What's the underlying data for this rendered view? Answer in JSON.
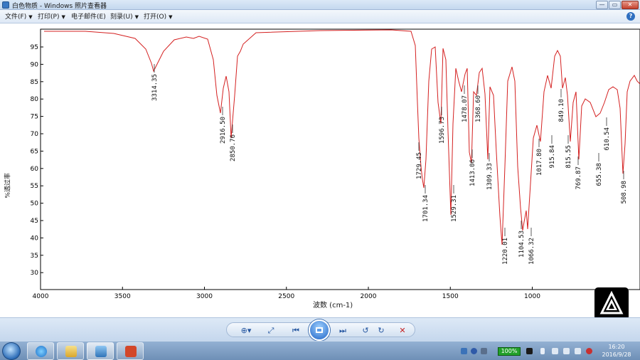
{
  "window": {
    "title": "白色物质 - Windows 照片查看器",
    "min_glyph": "—",
    "max_glyph": "▭",
    "close_glyph": "✕"
  },
  "menu": [
    {
      "label": "文件(F)",
      "caret": "▼"
    },
    {
      "label": "打印(P)",
      "caret": "▼"
    },
    {
      "label": "电子邮件(E)",
      "caret": ""
    },
    {
      "label": "刻录(U)",
      "caret": "▼"
    },
    {
      "label": "打开(O)",
      "caret": "▼"
    }
  ],
  "help_glyph": "?",
  "spectrum": {
    "y_axis_title": "%透过率",
    "x_axis_title": "波数 (cm-1)",
    "y_ticks": [
      "95",
      "90",
      "85",
      "80",
      "75",
      "70",
      "65",
      "60",
      "55",
      "50",
      "45",
      "40",
      "35",
      "30"
    ],
    "x_ticks": [
      "4000",
      "3500",
      "3000",
      "2500",
      "2000",
      "1500",
      "1000"
    ],
    "line_color": "#d42020",
    "peak_labels": [
      "3314.35",
      "2916.50",
      "2850.76",
      "1729.45",
      "1701.34",
      "1596.73",
      "1529.31",
      "1478.07",
      "1413.06",
      "1368.60",
      "1309.33",
      "1220.01",
      "1104.53",
      "1066.32",
      "1017.80",
      "915.84",
      "849.10",
      "815.55",
      "769.87",
      "655.38",
      "610.54",
      "508.98"
    ]
  },
  "controls": {
    "zoom": "⊕▾",
    "fit": "⤢",
    "prev": "⏮",
    "next": "⏭",
    "rotate_ccw": "↺",
    "rotate_cw": "↻",
    "delete": "✕"
  },
  "taskbar": {
    "battery": "100%",
    "time": "16:20",
    "date": "2016/9/28"
  }
}
